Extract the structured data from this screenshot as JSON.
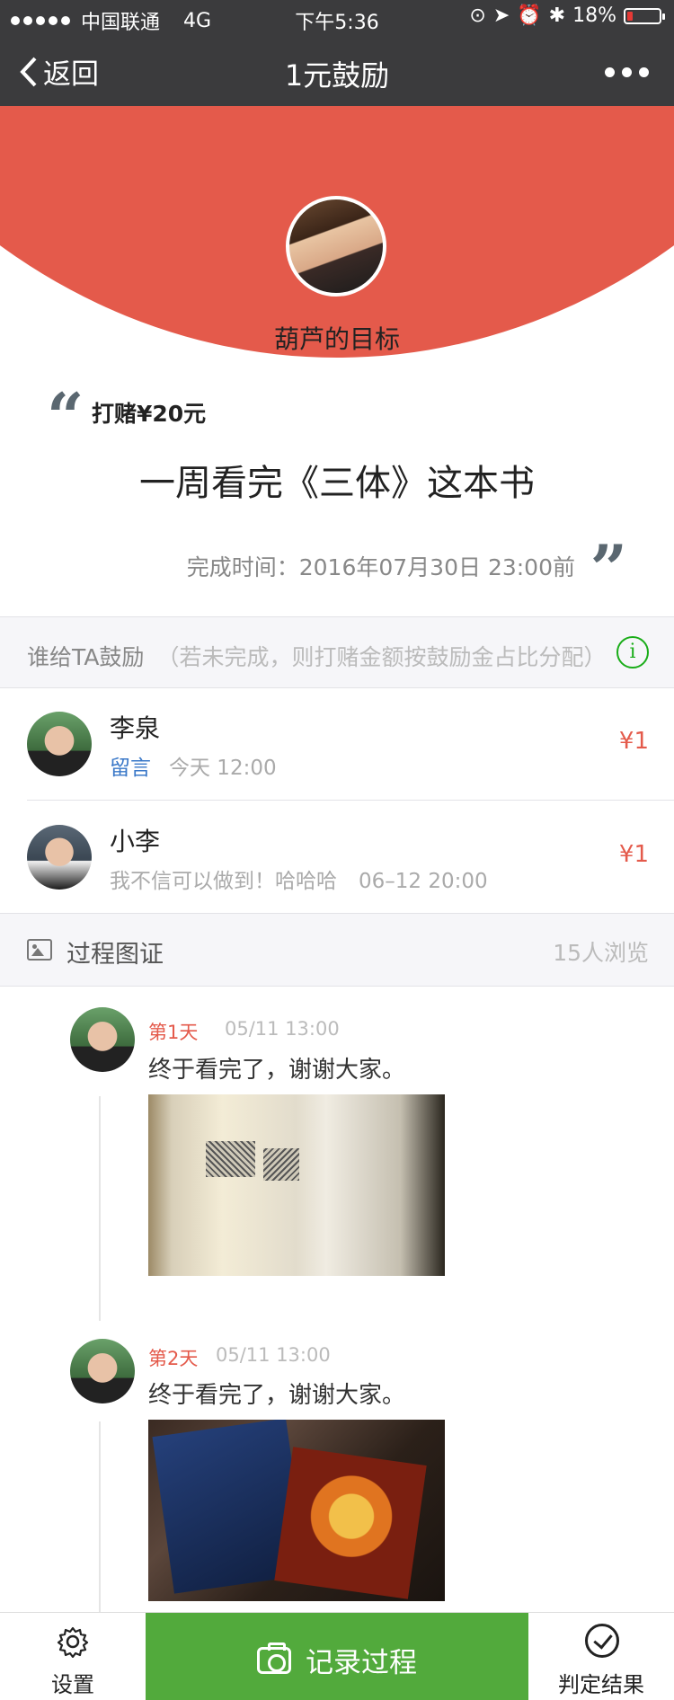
{
  "status_bar": {
    "carrier": "中国联通",
    "network": "4G",
    "time": "下午5:36",
    "battery": "18%"
  },
  "nav": {
    "back_label": "返回",
    "title": "1元鼓励"
  },
  "goal": {
    "owner_label": "葫芦的目标",
    "bet": "打赌¥20元",
    "text": "一周看完《三体》这本书",
    "deadline_label": "完成时间：",
    "deadline_value": "2016年07月30日  23:00前"
  },
  "encouragers_section": {
    "title": "谁给TA鼓励",
    "note": "（若未完成，则打赌金额按鼓励金占比分配）",
    "items": [
      {
        "name": "李泉",
        "link": "留言",
        "time": "今天 12:00",
        "amount": "¥1"
      },
      {
        "name": "小李",
        "message": "我不信可以做到！哈哈哈",
        "time": "06–12 20:00",
        "amount": "¥1"
      }
    ]
  },
  "process_section": {
    "title": "过程图证",
    "views": "15人浏览",
    "entries": [
      {
        "day": "第1天",
        "time": "05/11 13:00",
        "text": "终于看完了，谢谢大家。"
      },
      {
        "day": "第2天",
        "time": "05/11 13:00",
        "text": "终于看完了，谢谢大家。"
      }
    ]
  },
  "bottom_bar": {
    "settings": "设置",
    "record": "记录过程",
    "judge": "判定结果"
  },
  "colors": {
    "accent_red": "#e45a4b",
    "action_green": "#52aa3c",
    "info_green": "#1aad19",
    "nav_dark": "#3b3b3d"
  }
}
